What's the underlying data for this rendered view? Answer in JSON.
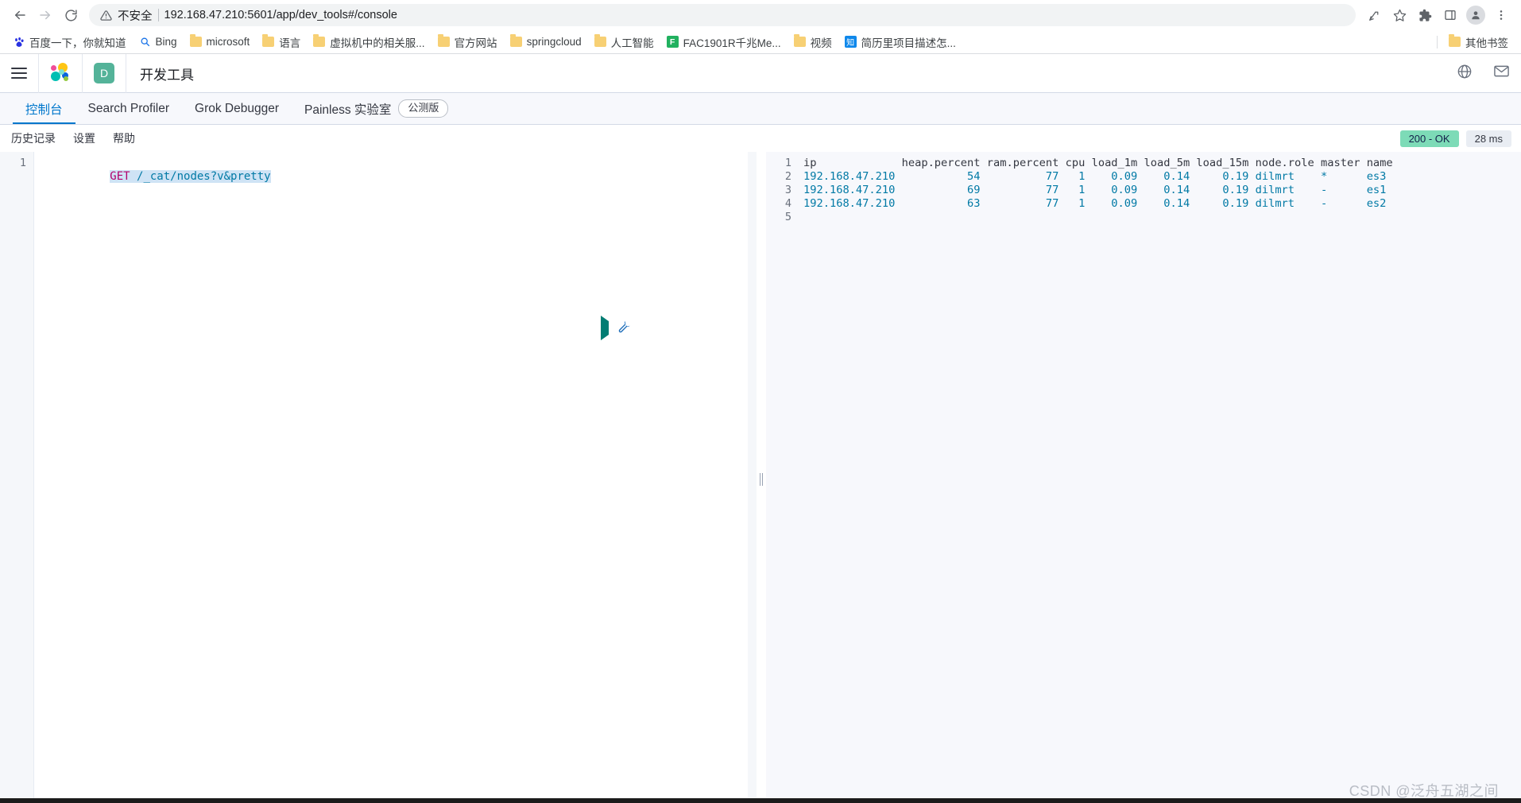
{
  "browser": {
    "nav": {
      "back": "back-arrow",
      "forward": "forward-arrow",
      "reload": "reload"
    },
    "omnibox": {
      "insecure_label": "不安全",
      "url": "192.168.47.210:5601/app/dev_tools#/console"
    },
    "toolbar_icons": [
      "share-icon",
      "star-icon",
      "extensions-icon",
      "sidepanel-icon",
      "profile-icon",
      "menu-kebab-icon"
    ],
    "bookmarks": [
      {
        "label": "百度一下，你就知道",
        "icon": "baidu-favicon"
      },
      {
        "label": "Bing",
        "icon": "bing-favicon"
      },
      {
        "label": "microsoft",
        "icon": "folder"
      },
      {
        "label": "语言",
        "icon": "folder"
      },
      {
        "label": "虚拟机中的相关服...",
        "icon": "folder"
      },
      {
        "label": "官方网站",
        "icon": "folder"
      },
      {
        "label": "springcloud",
        "icon": "folder"
      },
      {
        "label": "人工智能",
        "icon": "folder"
      },
      {
        "label": "FAC1901R千兆Me...",
        "icon": "f-favicon"
      },
      {
        "label": "视频",
        "icon": "folder"
      },
      {
        "label": "简历里项目描述怎...",
        "icon": "zhihu-favicon"
      }
    ],
    "other_bookmarks": {
      "label": "其他书签",
      "icon": "folder"
    }
  },
  "kibana": {
    "menu_icon": "hamburger-menu-icon",
    "logo_icon": "elastic-logo-icon",
    "space_badge": "D",
    "app_title": "开发工具",
    "header_right_icons": [
      "help-globe-icon",
      "news-mail-icon"
    ],
    "tabs": [
      {
        "label": "控制台",
        "active": true,
        "badge": null
      },
      {
        "label": "Search Profiler",
        "active": false,
        "badge": null
      },
      {
        "label": "Grok Debugger",
        "active": false,
        "badge": null
      },
      {
        "label": "Painless 实验室",
        "active": false,
        "badge": "公测版"
      }
    ]
  },
  "console": {
    "toolbar_links": [
      "历史记录",
      "设置",
      "帮助"
    ],
    "status": {
      "code": "200 - OK",
      "time": "28 ms"
    },
    "request": {
      "line_numbers": [
        "1"
      ],
      "method": "GET",
      "path": " /_cat/nodes?v&pretty"
    },
    "actions": {
      "play": "play-triangle-icon",
      "wrench": "wrench-icon"
    },
    "response": {
      "line_numbers": [
        "1",
        "2",
        "3",
        "4",
        "5"
      ],
      "header_line": "ip             heap.percent ram.percent cpu load_1m load_5m load_15m node.role master name",
      "rows": [
        "192.168.47.210           54          77   1    0.09    0.14     0.19 dilmrt    *      es3",
        "192.168.47.210           69          77   1    0.09    0.14     0.19 dilmrt    -      es1",
        "192.168.47.210           63          77   1    0.09    0.14     0.19 dilmrt    -      es2"
      ]
    }
  },
  "watermark": "CSDN @泛舟五湖之间",
  "colors": {
    "accent": "#0077cc",
    "status_ok_bg": "#7ddbb7",
    "space_badge_bg": "#54b399",
    "method_token": "#b3006b",
    "url_token": "#0079a5"
  }
}
